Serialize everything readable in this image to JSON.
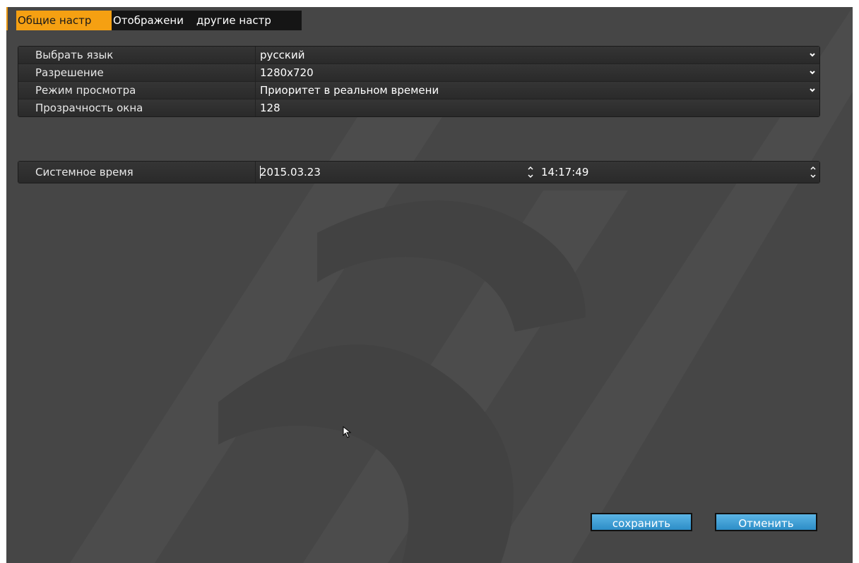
{
  "tabs": [
    {
      "label": "Общие настр",
      "active": true
    },
    {
      "label": "Отображени",
      "active": false
    },
    {
      "label": "другие  настр",
      "active": false
    }
  ],
  "settings": {
    "language": {
      "label": "Выбрать язык",
      "value": "русский"
    },
    "resolution": {
      "label": "Разрешение",
      "value": "1280x720"
    },
    "view_mode": {
      "label": "Режим просмотра",
      "value": "Приоритет в реальном времени"
    },
    "transparency": {
      "label": "Прозрачность окна",
      "value": "128"
    }
  },
  "system_time": {
    "label": "Системное время",
    "date": "2015.03.23",
    "time": "14:17:49"
  },
  "buttons": {
    "save": "сохранить",
    "cancel": "Отменить"
  },
  "colors": {
    "accent": "#f5a012",
    "panel": "#464646",
    "button": "#3a9bd5"
  },
  "icons": {
    "dropdown": "chevron-down-icon",
    "spinner": "up-down-spinner-icon",
    "cursor": "mouse-pointer-icon"
  }
}
